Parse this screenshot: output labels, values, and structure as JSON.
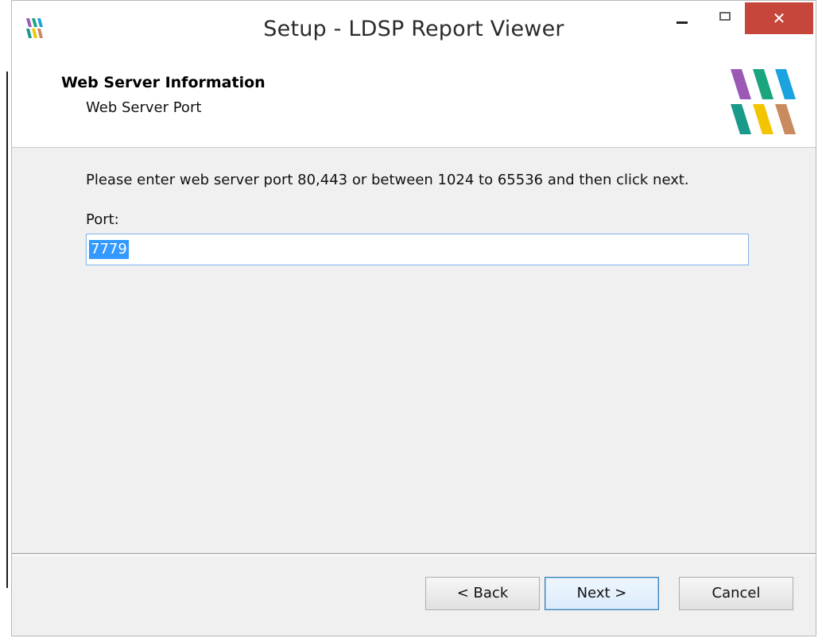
{
  "window": {
    "title": "Setup - LDSP Report Viewer",
    "close_glyph": "✕"
  },
  "header": {
    "title": "Web Server Information",
    "subtitle": "Web Server Port"
  },
  "body": {
    "instructions": "Please enter web server port 80,443 or between 1024 to 65536 and then click next.",
    "port_label": "Port:",
    "port_value": "7779"
  },
  "footer": {
    "back_label": "< Back",
    "next_label": "Next >",
    "cancel_label": "Cancel"
  },
  "icons": {
    "app_logo": "ldsp-logo-icon",
    "minimize": "minimize-icon",
    "maximize": "maximize-icon",
    "close": "close-icon"
  },
  "colors": {
    "logo_purple": "#9b59b6",
    "logo_green": "#1aa57f",
    "logo_blue": "#1aa3de",
    "logo_teal": "#1a9a8a",
    "logo_yellow": "#f2c500",
    "logo_tan": "#c98a5e",
    "close_button": "#c7463b",
    "selection": "#3399ff"
  }
}
